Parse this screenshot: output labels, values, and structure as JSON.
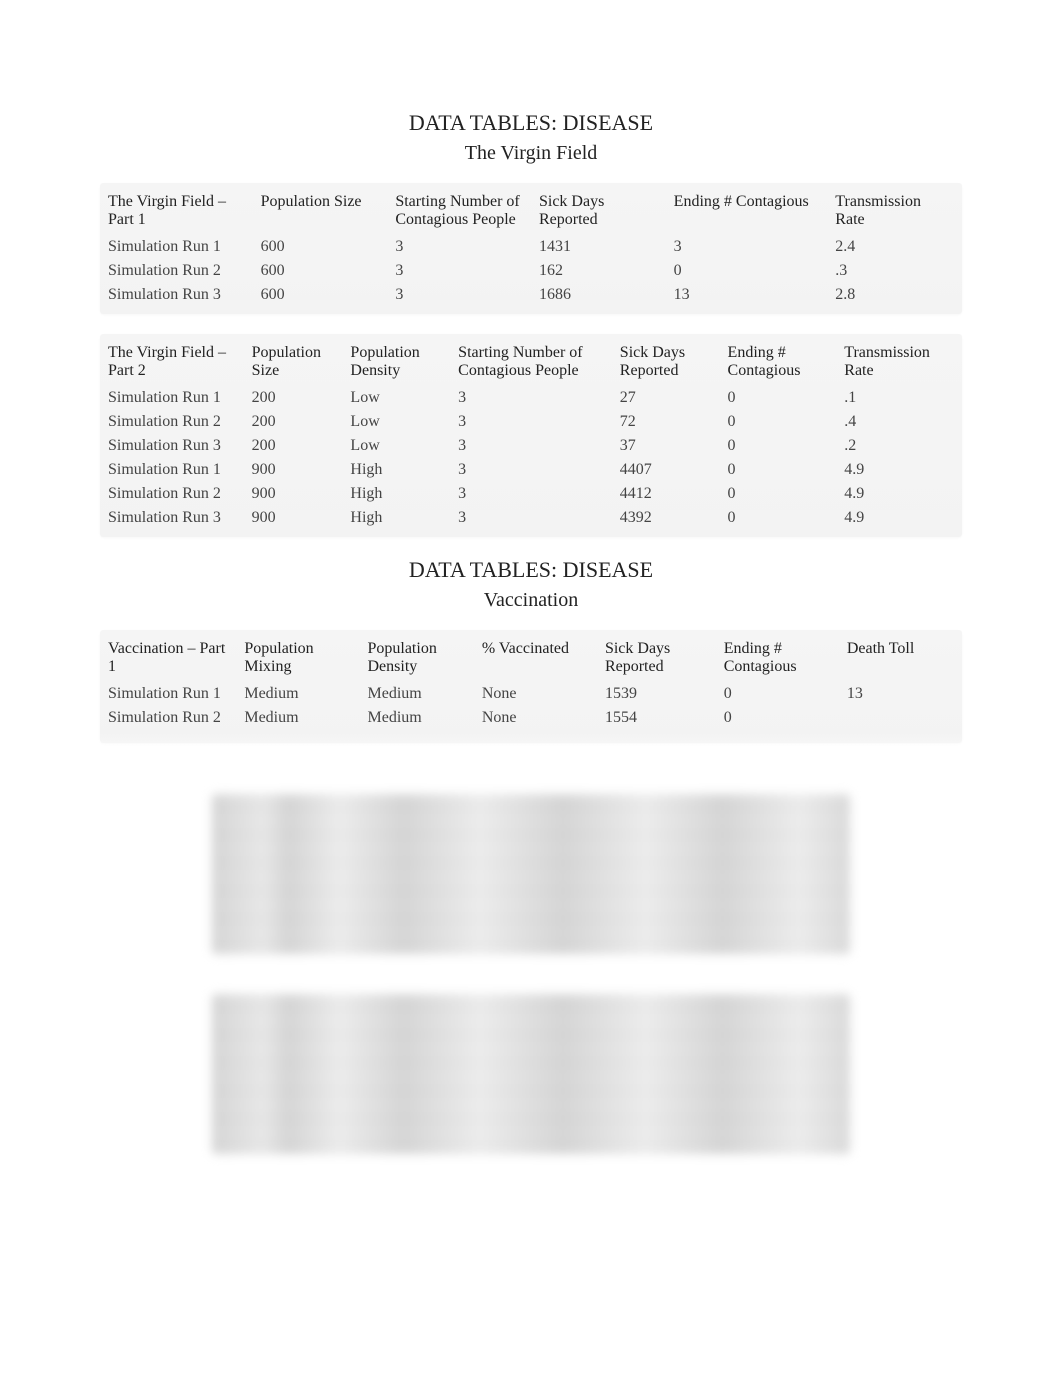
{
  "section1": {
    "title": "DATA TABLES: DISEASE",
    "subtitle": "The Virgin Field"
  },
  "table1": {
    "headers": {
      "c0": "The Virgin Field – Part 1",
      "c1": "Population Size",
      "c2": "Starting Number of Contagious People",
      "c3": "Sick Days Reported",
      "c4": "Ending # Contagious",
      "c5": "Transmission Rate"
    },
    "rows": [
      {
        "c0": "Simulation Run 1",
        "c1": "600",
        "c2": "3",
        "c3": "1431",
        "c4": "3",
        "c5": "2.4"
      },
      {
        "c0": "Simulation Run 2",
        "c1": "600",
        "c2": "3",
        "c3": "162",
        "c4": "0",
        "c5": ".3"
      },
      {
        "c0": "Simulation Run 3",
        "c1": "600",
        "c2": "3",
        "c3": "1686",
        "c4": "13",
        "c5": "2.8"
      }
    ]
  },
  "table2": {
    "headers": {
      "c0": "The Virgin Field – Part 2",
      "c1": "Population Size",
      "c2": "Population Density",
      "c3": "Starting Number of Contagious People",
      "c4": "Sick Days Reported",
      "c5": "Ending # Contagious",
      "c6": "Transmission Rate"
    },
    "rows": [
      {
        "c0": "Simulation Run 1",
        "c1": "200",
        "c2": "Low",
        "c3": "3",
        "c4": "27",
        "c5": "0",
        "c6": ".1"
      },
      {
        "c0": "Simulation Run 2",
        "c1": "200",
        "c2": "Low",
        "c3": "3",
        "c4": "72",
        "c5": "0",
        "c6": ".4"
      },
      {
        "c0": "Simulation Run 3",
        "c1": "200",
        "c2": "Low",
        "c3": "3",
        "c4": "37",
        "c5": "0",
        "c6": ".2"
      },
      {
        "c0": "Simulation Run 1",
        "c1": "900",
        "c2": "High",
        "c3": "3",
        "c4": "4407",
        "c5": "0",
        "c6": "4.9"
      },
      {
        "c0": "Simulation Run 2",
        "c1": "900",
        "c2": "High",
        "c3": "3",
        "c4": "4412",
        "c5": "0",
        "c6": "4.9"
      },
      {
        "c0": "Simulation Run 3",
        "c1": "900",
        "c2": "High",
        "c3": "3",
        "c4": "4392",
        "c5": "0",
        "c6": "4.9"
      }
    ]
  },
  "section2": {
    "title": "DATA TABLES: DISEASE",
    "subtitle": "Vaccination"
  },
  "table3": {
    "headers": {
      "c0": "Vaccination – Part 1",
      "c1": "Population Mixing",
      "c2": "Population Density",
      "c3": "% Vaccinated",
      "c4": "Sick Days Reported",
      "c5": "Ending # Contagious",
      "c6": "Death Toll"
    },
    "rows": [
      {
        "c0": "Simulation Run 1",
        "c1": "Medium",
        "c2": "Medium",
        "c3": "None",
        "c4": "1539",
        "c5": "0",
        "c6": "13"
      },
      {
        "c0": "Simulation Run 2",
        "c1": "Medium",
        "c2": "Medium",
        "c3": "None",
        "c4": "1554",
        "c5": "0",
        "c6": ""
      }
    ]
  }
}
